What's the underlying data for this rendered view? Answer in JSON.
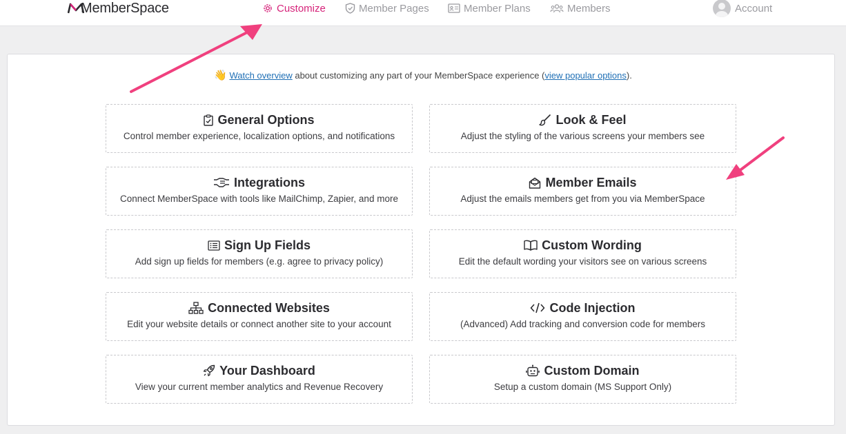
{
  "brand": {
    "name": "MemberSpace"
  },
  "nav": {
    "customize": "Customize",
    "member_pages": "Member Pages",
    "member_plans": "Member Plans",
    "members": "Members",
    "account": "Account"
  },
  "colors": {
    "accent": "#d6237a",
    "arrow": "#f0407e",
    "link": "#1f6fb5"
  },
  "intro": {
    "emoji": "👋",
    "link1": "Watch overview",
    "text1": " about customizing any part of your MemberSpace experience (",
    "link2": "view popular options",
    "text2": ")."
  },
  "tiles": [
    {
      "icon": "clipboard-check-icon",
      "title": "General Options",
      "desc": "Control member experience, localization options, and notifications"
    },
    {
      "icon": "brush-icon",
      "title": "Look & Feel",
      "desc": "Adjust the styling of the various screens your members see"
    },
    {
      "icon": "handshake-icon",
      "title": "Integrations",
      "desc": "Connect MemberSpace with tools like MailChimp, Zapier, and more"
    },
    {
      "icon": "envelope-open-icon",
      "title": "Member Emails",
      "desc": "Adjust the emails members get from you via MemberSpace"
    },
    {
      "icon": "list-icon",
      "title": "Sign Up Fields",
      "desc": "Add sign up fields for members (e.g. agree to privacy policy)"
    },
    {
      "icon": "book-open-icon",
      "title": "Custom Wording",
      "desc": "Edit the default wording your visitors see on various screens"
    },
    {
      "icon": "sitemap-icon",
      "title": "Connected Websites",
      "desc": "Edit your website details or connect another site to your account"
    },
    {
      "icon": "code-icon",
      "title": "Code Injection",
      "desc": "(Advanced) Add tracking and conversion code for members"
    },
    {
      "icon": "rocket-icon",
      "title": "Your Dashboard",
      "desc": "View your current member analytics and Revenue Recovery"
    },
    {
      "icon": "robot-icon",
      "title": "Custom Domain",
      "desc": "Setup a custom domain (MS Support Only)"
    }
  ]
}
